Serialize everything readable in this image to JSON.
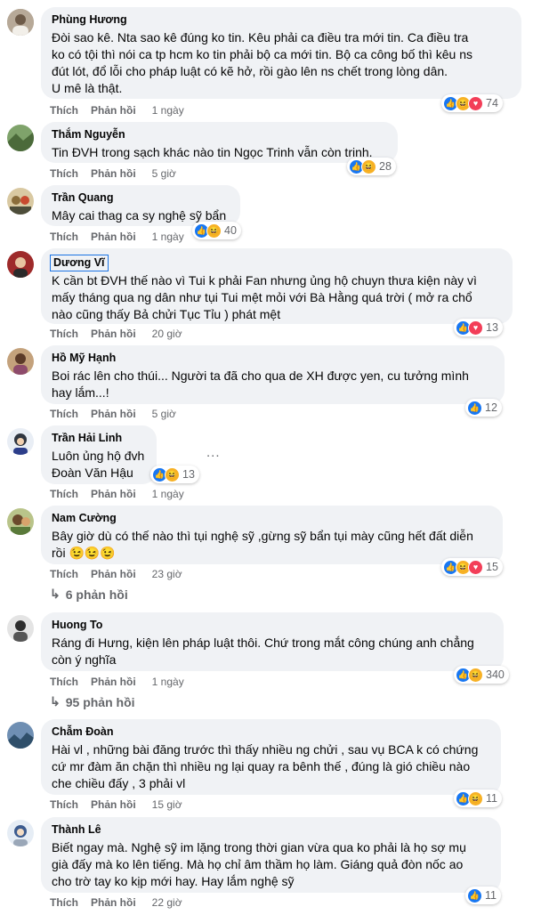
{
  "labels": {
    "like": "Thích",
    "reply": "Phản hồi"
  },
  "comments": [
    {
      "name": "Phùng Hương",
      "text": "Đòi sao kê. Nta sao kê đúng ko tin. Kêu phải ca điều tra mới tin. Ca điều tra\nko có tội thì nói ca tp hcm ko tin phải bộ ca mới tin. Bộ ca công bố thì kêu ns\nđút lót, đổ lỗi cho pháp luật có kẽ hở, rồi gào lên ns chết trong lòng dân.\nU mê là thật.",
      "time": "1 ngày",
      "reactions": [
        "like",
        "haha",
        "heart"
      ],
      "count": "74"
    },
    {
      "name": "Thắm Nguyễn",
      "text": "Tin ĐVH trong sạch khác nào tin Ngọc Trinh vẫn còn trinh.",
      "time": "5 giờ",
      "reactions": [
        "like",
        "haha"
      ],
      "count": "28"
    },
    {
      "name": "Trần Quang",
      "text": "Mây cai thag ca sy nghệ sỹ bẩn",
      "time": "1 ngày",
      "reactions": [
        "like",
        "haha"
      ],
      "count": "40"
    },
    {
      "name": "Dương Vĩ",
      "text": "K cần bt ĐVH thế nào vì Tui k phải Fan nhưng ủng hộ chuyn thưa kiện này vì\nmấy tháng qua ng dân như tụi Tui mệt mỏi với Bà Hằng quá trời ( mở ra chổ\nnào cũng thấy Bả chửi Tục Tỉu ) phát mệt",
      "time": "20 giờ",
      "reactions": [
        "like",
        "heart"
      ],
      "count": "13"
    },
    {
      "name": "Hồ Mỹ Hạnh",
      "text": "Boi rác lên cho thúi... Người ta đã cho qua de XH được yen, cu tưởng mình\nhay lắm...!",
      "time": "5 giờ",
      "reactions": [
        "like"
      ],
      "count": "12"
    },
    {
      "name": "Trần Hải Linh",
      "text": "Luôn ủng hộ đvh\nĐoàn Văn Hậu",
      "time": "1 ngày",
      "reactions": [
        "like",
        "haha"
      ],
      "count": "13",
      "more": "..."
    },
    {
      "name": "Nam Cường",
      "text": "Bây giờ dù có thế nào thì tụi nghệ sỹ ,gừng sỹ bẩn tụi mày cũng hết đất diễn\nrồi 😉😉😉",
      "time": "23 giờ",
      "reactions": [
        "like",
        "haha",
        "heart"
      ],
      "count": "15",
      "replies": "6 phản hồi"
    },
    {
      "name": "Huong To",
      "text": "Ráng đi Hưng, kiện lên pháp luật thôi. Chứ trong mắt công chúng anh chẳng\ncòn ý nghĩa",
      "time": "1 ngày",
      "reactions": [
        "like",
        "haha"
      ],
      "count": "340",
      "replies": "95 phản hồi"
    },
    {
      "name": "Chẫm Đoàn",
      "text": "Hài vl , những bài đăng trước thì thấy nhiều ng chửi , sau vụ BCA k có chứng\ncứ mr đàm ăn chặn thì nhiều ng lại quay ra bênh thế , đúng là gió chiều nào\nche chiều đấy , 3 phải vl",
      "time": "15 giờ",
      "reactions": [
        "like",
        "haha"
      ],
      "count": "11"
    },
    {
      "name": "Thành Lê",
      "text": "Biết ngay mà. Nghệ sỹ im lặng trong thời gian vừa qua ko phải là họ sợ mụ\ngià đấy mà ko lên tiếng. Mà họ chỉ âm thầm họ làm. Giáng quả đòn nốc ao\ncho trờ tay ko kịp mới hay. Hay lắm nghệ sỹ",
      "time": "22 giờ",
      "reactions": [
        "like"
      ],
      "count": "11"
    }
  ]
}
